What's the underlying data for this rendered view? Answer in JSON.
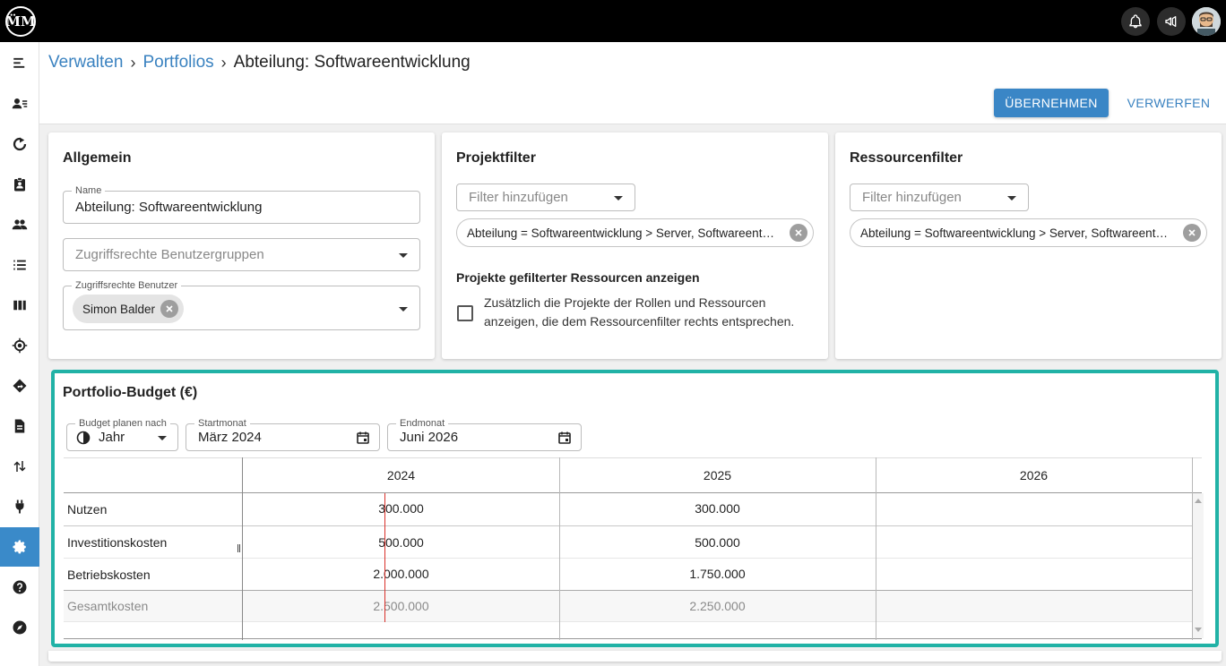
{
  "app": {
    "logo_text": "M̈M"
  },
  "topbar": {
    "icons": [
      "bell-icon",
      "megaphone-icon",
      "user-avatar"
    ]
  },
  "sidebar": {
    "items": [
      {
        "icon": "menu-icon",
        "active": false
      },
      {
        "icon": "user-list-icon",
        "active": false
      },
      {
        "icon": "refresh-chart-icon",
        "active": false
      },
      {
        "icon": "clipboard-user-icon",
        "active": false
      },
      {
        "icon": "people-icon",
        "active": false
      },
      {
        "icon": "list-icon",
        "active": false
      },
      {
        "icon": "columns-icon",
        "active": false
      },
      {
        "icon": "target-icon",
        "active": false
      },
      {
        "icon": "directions-icon",
        "active": false
      },
      {
        "icon": "document-icon",
        "active": false
      },
      {
        "icon": "swap-vertical-icon",
        "active": false
      },
      {
        "icon": "plug-icon",
        "active": false
      },
      {
        "icon": "gear-icon",
        "active": true
      },
      {
        "icon": "help-icon",
        "active": false
      },
      {
        "icon": "compass-icon",
        "active": false
      }
    ],
    "active_color": "#3a8ac9"
  },
  "header": {
    "breadcrumb": {
      "item1": "Verwalten",
      "item2": "Portfolios",
      "current": "Abteilung: Softwareentwicklung",
      "separator": "›"
    },
    "apply_label": "ÜBERNEHMEN",
    "discard_label": "VERWERFEN"
  },
  "general": {
    "title": "Allgemein",
    "name_label": "Name",
    "name_value": "Abteilung: Softwareentwicklung",
    "groups_placeholder": "Zugriffsrechte Benutzergruppen",
    "users_label": "Zugriffsrechte Benutzer",
    "user_chip": "Simon Balder"
  },
  "project_filter": {
    "title": "Projektfilter",
    "add_placeholder": "Filter hinzufügen",
    "chip": "Abteilung = Softwareentwicklung > Server, Softwareentwicklung > Client",
    "subheading": "Projekte gefilterter Ressourcen anzeigen",
    "checkbox_text_1": "Zusätzlich die Projekte der Rollen und Ressourcen",
    "checkbox_text_2": "anzeigen, die dem Ressourcenfilter rechts entsprechen.",
    "checkbox_checked": false
  },
  "resource_filter": {
    "title": "Ressourcenfilter",
    "add_placeholder": "Filter hinzufügen",
    "chip": "Abteilung = Softwareentwicklung > Server, Softwareentwicklung > Client"
  },
  "budget": {
    "title": "Portfolio-Budget (€)",
    "plan_by_label": "Budget planen nach",
    "plan_by_value": "Jahr",
    "start_label": "Startmonat",
    "start_value": "März 2024",
    "end_label": "Endmonat",
    "end_value": "Juni 2026",
    "highlight_color": "#21b2a6",
    "table": {
      "columns": [
        "2024",
        "2025",
        "2026"
      ],
      "rows": [
        {
          "label": "Nutzen",
          "values": [
            "300.000",
            "300.000",
            ""
          ],
          "muted": false
        },
        {
          "label": "Investitionskosten",
          "values": [
            "500.000",
            "500.000",
            ""
          ],
          "muted": false
        },
        {
          "label": "Betriebskosten",
          "values": [
            "2.000.000",
            "1.750.000",
            ""
          ],
          "muted": false
        },
        {
          "label": "Gesamtkosten",
          "values": [
            "2.500.000",
            "2.250.000",
            ""
          ],
          "muted": true
        }
      ]
    }
  }
}
